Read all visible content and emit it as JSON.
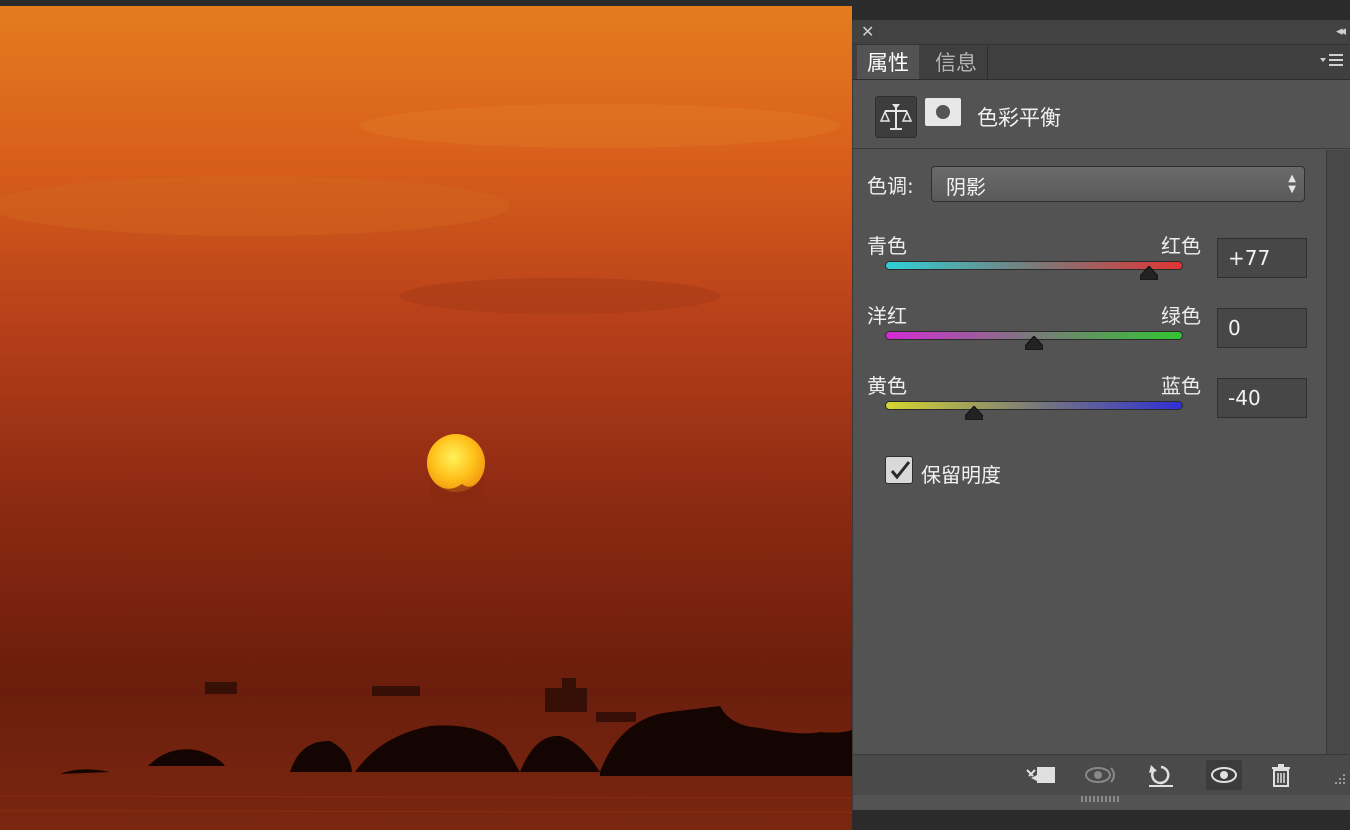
{
  "panel": {
    "close_glyph": "✕",
    "collapse_glyph": "◂◂",
    "tabs": [
      {
        "label": "属性"
      },
      {
        "label": "信息"
      }
    ],
    "menu_icon": "panel-menu-icon",
    "adjustment": {
      "title": "色彩平衡",
      "icons": [
        "color-balance-icon",
        "layer-mask-icon"
      ]
    },
    "tone": {
      "label": "色调:",
      "value": "阴影"
    },
    "sliders": [
      {
        "left": "青色",
        "right": "红色",
        "value": "+77",
        "level": 77,
        "colors": [
          "#2fd1d6",
          "#e23434"
        ]
      },
      {
        "left": "洋红",
        "right": "绿色",
        "value": "0",
        "level": 0,
        "colors": [
          "#d52bd5",
          "#31c531"
        ]
      },
      {
        "left": "黄色",
        "right": "蓝色",
        "value": "-40",
        "level": -40,
        "colors": [
          "#d6d631",
          "#2f2fd6"
        ]
      }
    ],
    "preserve_luminosity": {
      "label": "保留明度",
      "checked": true
    },
    "bottom_buttons": [
      "clip-to-layer-icon",
      "view-previous-state-icon",
      "reset-icon",
      "visibility-eye-icon",
      "trash-icon"
    ]
  }
}
